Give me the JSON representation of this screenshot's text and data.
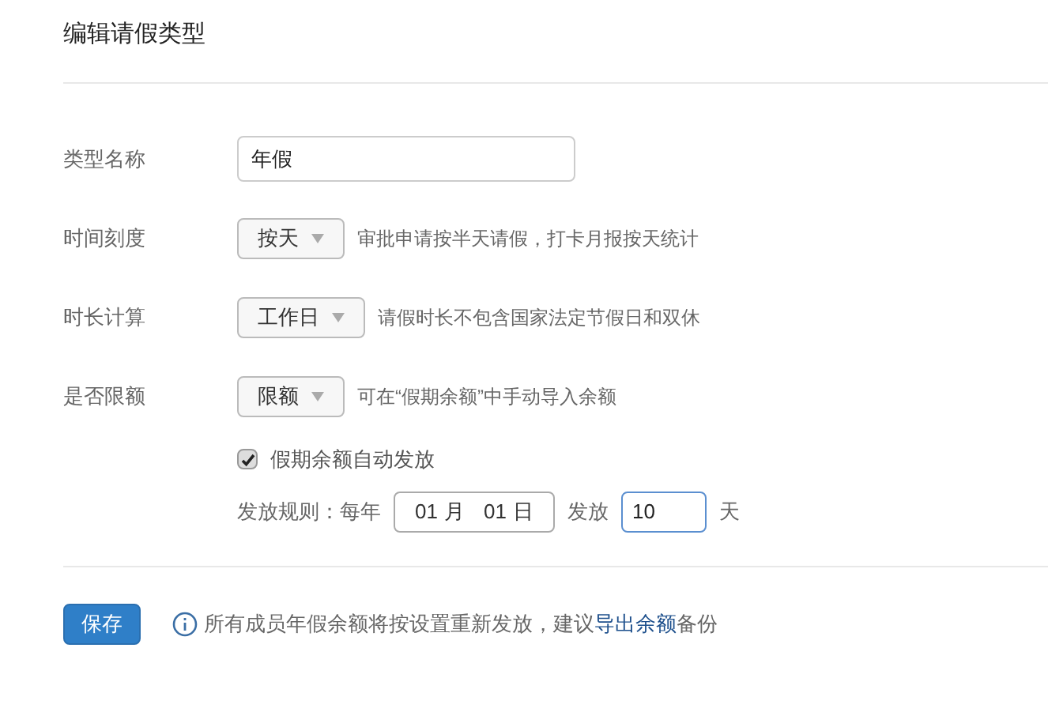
{
  "title": "编辑请假类型",
  "fields": [
    {
      "kind": "text",
      "label": "类型名称",
      "value": "年假"
    },
    {
      "kind": "select",
      "label": "时间刻度",
      "value": "按天",
      "hint": "审批申请按半天请假，打卡月报按天统计"
    },
    {
      "kind": "select",
      "label": "时长计算",
      "value": "工作日",
      "hint": "请假时长不包含国家法定节假日和双休"
    },
    {
      "kind": "select",
      "label": "是否限额",
      "value": "限额",
      "hint": "可在“假期余额”中手动导入余额"
    }
  ],
  "auto_grant": {
    "label": "假期余额自动发放",
    "checked": true
  },
  "rule": {
    "label": "发放规则：每年",
    "month": "01",
    "month_unit": "月",
    "day": "01",
    "day_unit": "日",
    "grant_label": "发放",
    "amount": "10",
    "amount_focused": true,
    "unit": "天"
  },
  "save_button": "保存",
  "notice": {
    "before": "所有成员年假余额将按设置重新发放，建议",
    "link": "导出余额",
    "after": "备份"
  }
}
